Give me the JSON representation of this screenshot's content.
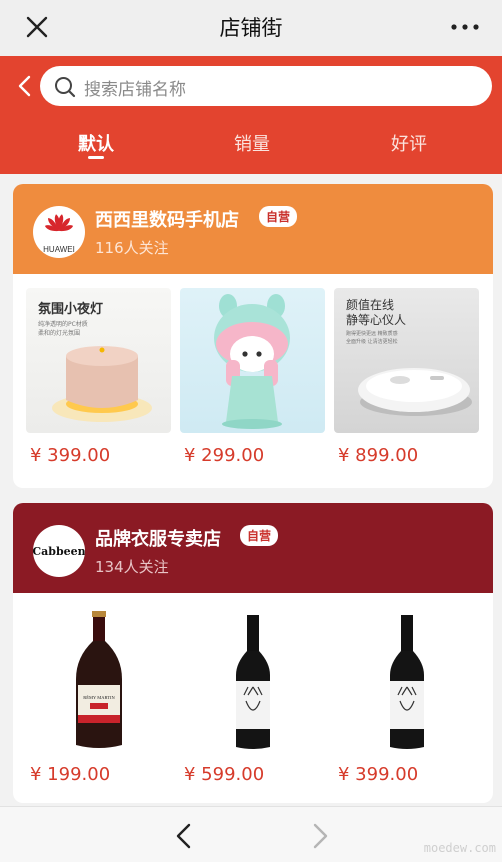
{
  "window": {
    "title": "店铺街"
  },
  "search": {
    "placeholder": "搜索店铺名称"
  },
  "tabs": [
    {
      "label": "默认"
    },
    {
      "label": "销量"
    },
    {
      "label": "好评"
    }
  ],
  "shops": [
    {
      "name": "西西里数码手机店",
      "badge": "自营",
      "followers": "116人关注",
      "logo_text": "HUAWEI",
      "products": [
        {
          "price": "¥ 399.00",
          "img_title": "氛围小夜灯",
          "img_sub": "纯净透明的PC材质\n柔和的灯光氛围"
        },
        {
          "price": "¥ 299.00"
        },
        {
          "price": "¥ 899.00",
          "img_title": "颜值在线\n静等心仪人",
          "img_sub": "跑得更快更远 精致质感\n全面升级 让清洁更轻松"
        }
      ]
    },
    {
      "name": "品牌衣服专卖店",
      "badge": "自营",
      "followers": "134人关注",
      "logo_text": "Cabbeen",
      "products": [
        {
          "price": "¥ 199.00",
          "label": "RÉMY MARTIN"
        },
        {
          "price": "¥ 599.00"
        },
        {
          "price": "¥ 399.00"
        }
      ]
    }
  ],
  "watermark": "moedew.com",
  "colors": {
    "header_red": "#e3442f",
    "shop1_orange": "#ef8c3e",
    "shop2_maroon": "#8b1a24",
    "price_red": "#d63b2b"
  }
}
